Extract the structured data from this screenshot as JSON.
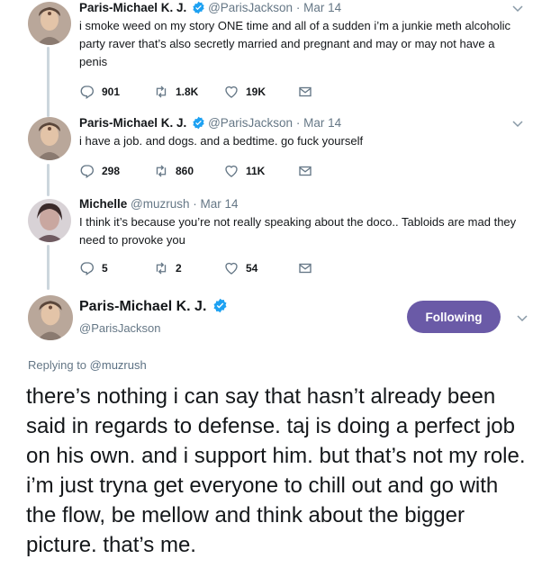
{
  "tweets": [
    {
      "name": "Paris-Michael K. J.",
      "handle": "@ParisJackson",
      "date": "Mar 14",
      "text": "i smoke weed on my story ONE time and all of a sudden i’m a junkie meth alcoholic party raver that’s also secretly married and pregnant and may or may not have a penis",
      "replies": "901",
      "retweets": "1.8K",
      "likes": "19K"
    },
    {
      "name": "Paris-Michael K. J.",
      "handle": "@ParisJackson",
      "date": "Mar 14",
      "text": "i have a job. and dogs. and a bedtime. go fuck yourself",
      "replies": "298",
      "retweets": "860",
      "likes": "11K"
    },
    {
      "name": "Michelle",
      "handle": "@muzrush",
      "date": "Mar 14",
      "text": "I think it’s because you’re not really speaking about the doco.. Tabloids are mad they need to provoke you",
      "replies": "5",
      "retweets": "2",
      "likes": "54"
    }
  ],
  "main_tweet": {
    "name": "Paris-Michael K. J.",
    "handle": "@ParisJackson",
    "follow_label": "Following",
    "replying_prefix": "Replying to",
    "replying_handle": "@muzrush",
    "text": "there’s nothing i can say that hasn’t already been said in regards to defense. taj is doing a perfect job on his own. and i support him. but that’s not my role. i’m just tryna get everyone to chill out and go with the flow, be mellow and think about the bigger picture. that’s me."
  },
  "colors": {
    "follow_button": "#6a5aa7",
    "verified": "#1da1f2",
    "thread_line": "#ccd6dd",
    "meta_text": "#657786"
  },
  "icons": [
    "reply-icon",
    "retweet-icon",
    "like-icon",
    "dm-icon",
    "verified-icon",
    "chevron-down-icon"
  ]
}
